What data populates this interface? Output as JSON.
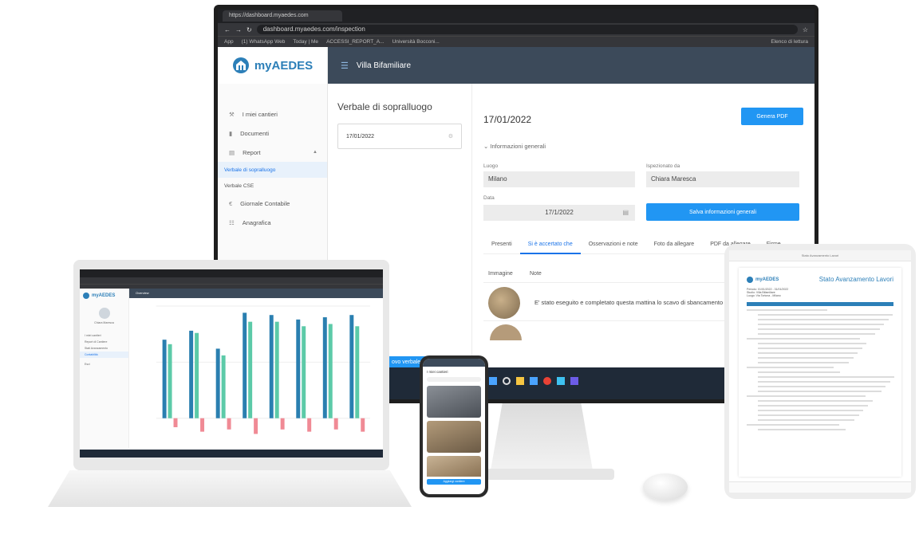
{
  "monitor": {
    "browser": {
      "tab_title": "https://dashboard.myaedes.com",
      "url": "dashboard.myaedes.com/inspection",
      "bookmarks": [
        "App",
        "(1) WhatsApp Web",
        "Today | Me",
        "ACCESSI_REPORT_A...",
        "Università Bocconi..."
      ],
      "bookmarks_right": "Elenco di lettura"
    },
    "app": {
      "logo": "myAEDES",
      "header_title": "Villa Bifamiliare",
      "sidebar": {
        "items": [
          "I miei cantieri",
          "Documenti",
          "Report"
        ],
        "sub_items": [
          "Verbale di sopralluogo",
          "Verbale CSE"
        ],
        "items_after": [
          "Giornale Contabile",
          "Anagrafica"
        ]
      },
      "list": {
        "title": "Verbale di sopralluogo",
        "card_date": "17/01/2022"
      },
      "detail": {
        "date": "17/01/2022",
        "generate_pdf": "Genera PDF",
        "section": "Informazioni generali",
        "luogo_label": "Luogo",
        "luogo_value": "Milano",
        "ispezione_label": "Ispezionato da",
        "ispezione_value": "Chiara Maresca",
        "data_label": "Data",
        "data_value": "17/1/2022",
        "save_button": "Salva informazioni generali",
        "tabs": [
          "Presenti",
          "Si è accertato che",
          "Osservazioni e note",
          "Foto da allegare",
          "PDF da allegare",
          "Firme"
        ],
        "active_tab": 1,
        "table_headers": [
          "Immagine",
          "Note"
        ],
        "row_note": "E' stato eseguito e completato questa mattina lo scavo di sbancamento"
      },
      "new_button": "ovo verbale"
    }
  },
  "laptop": {
    "logo": "myAEDES",
    "header": "Overview",
    "user_name": "Chiara Maresca",
    "nav": [
      "I miei cantieri",
      "Report di Cantiere",
      "Stati Avanzamento",
      "Contabilità"
    ],
    "logout": "Esci"
  },
  "chart_data": {
    "type": "bar",
    "series": [
      {
        "name": "",
        "color": "#2a7fb0",
        "values": [
          70,
          78,
          62,
          94,
          92,
          88,
          90,
          92
        ]
      },
      {
        "name": "",
        "color": "#5ccaa8",
        "values": [
          66,
          76,
          56,
          86,
          86,
          82,
          84,
          82
        ]
      },
      {
        "name": "",
        "color": "#f08a95",
        "values": [
          -8,
          -12,
          -10,
          -14,
          -10,
          -12,
          -10,
          -12
        ]
      }
    ],
    "ylim": [
      -20,
      100
    ]
  },
  "phone": {
    "title": "I miei cantieri",
    "footer": "Aggiungi cantiere"
  },
  "tablet": {
    "title_bar": "Stato Avanzamento Lavori",
    "logo": "myAEDES",
    "document_title": "Stato Avanzamento Lavori",
    "meta": [
      "Periodo: 01/01/2022 - 31/01/2022",
      "Studio: Villa Bifamiliare",
      "Luogo: Via Tortona - Milano"
    ]
  },
  "colors": {
    "brand": "#2c7fb8",
    "header": "#3c4a5a",
    "primary_button": "#2196f3"
  }
}
